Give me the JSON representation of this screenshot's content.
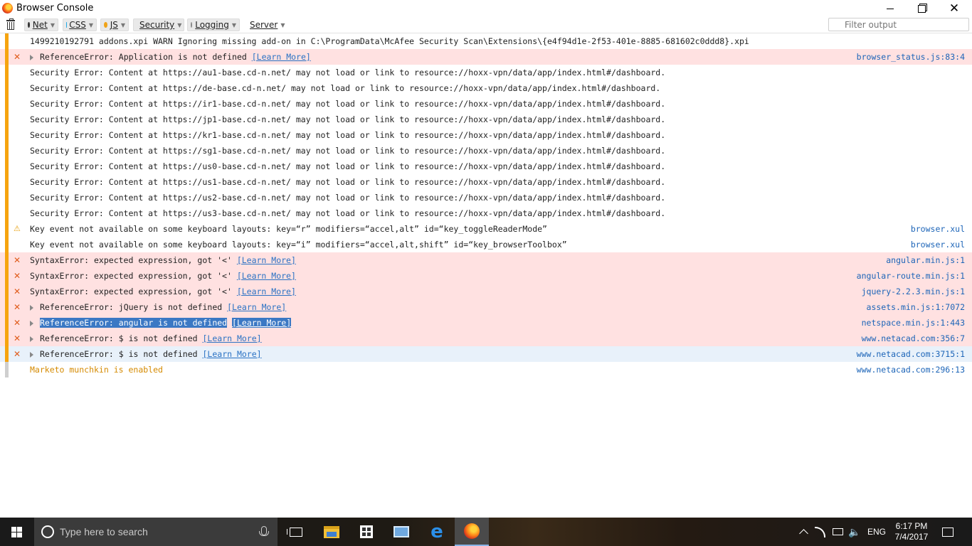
{
  "window": {
    "title": "Browser Console",
    "min_glyph": "",
    "close_glyph": "✕"
  },
  "toolbar": {
    "filters": [
      {
        "label": "Net",
        "color": "#333333"
      },
      {
        "label": "CSS",
        "color": "#1fa8e8"
      },
      {
        "label": "JS",
        "color": "#f0a318"
      },
      {
        "label": "Security",
        "color": "#e23b3b"
      },
      {
        "label": "Logging",
        "color": "#8a8a8a"
      },
      {
        "label": "Server",
        "color": "#3aa23a"
      }
    ],
    "filter_placeholder": "Filter output"
  },
  "console": {
    "rows": [
      {
        "type": "log",
        "sev": "",
        "twisty": false,
        "text": "1499210192791 addons.xpi WARN Ignoring missing add-on in C:\\ProgramData\\McAfee Security Scan\\Extensions\\{e4f94d1e-2f53-401e-8885-681602c0ddd8}.xpi",
        "link": "",
        "src": ""
      },
      {
        "type": "error",
        "sev": "✕",
        "twisty": true,
        "text": "ReferenceError: Application is not defined",
        "link": "[Learn More]",
        "src": "browser_status.js:83:4"
      },
      {
        "type": "log",
        "sev": "",
        "twisty": false,
        "text": "Security Error: Content at https://au1-base.cd-n.net/ may not load or link to resource://hoxx-vpn/data/app/index.html#/dashboard.",
        "link": "",
        "src": ""
      },
      {
        "type": "log",
        "sev": "",
        "twisty": false,
        "text": "Security Error: Content at https://de-base.cd-n.net/ may not load or link to resource://hoxx-vpn/data/app/index.html#/dashboard.",
        "link": "",
        "src": ""
      },
      {
        "type": "log",
        "sev": "",
        "twisty": false,
        "text": "Security Error: Content at https://ir1-base.cd-n.net/ may not load or link to resource://hoxx-vpn/data/app/index.html#/dashboard.",
        "link": "",
        "src": ""
      },
      {
        "type": "log",
        "sev": "",
        "twisty": false,
        "text": "Security Error: Content at https://jp1-base.cd-n.net/ may not load or link to resource://hoxx-vpn/data/app/index.html#/dashboard.",
        "link": "",
        "src": ""
      },
      {
        "type": "log",
        "sev": "",
        "twisty": false,
        "text": "Security Error: Content at https://kr1-base.cd-n.net/ may not load or link to resource://hoxx-vpn/data/app/index.html#/dashboard.",
        "link": "",
        "src": ""
      },
      {
        "type": "log",
        "sev": "",
        "twisty": false,
        "text": "Security Error: Content at https://sg1-base.cd-n.net/ may not load or link to resource://hoxx-vpn/data/app/index.html#/dashboard.",
        "link": "",
        "src": ""
      },
      {
        "type": "log",
        "sev": "",
        "twisty": false,
        "text": "Security Error: Content at https://us0-base.cd-n.net/ may not load or link to resource://hoxx-vpn/data/app/index.html#/dashboard.",
        "link": "",
        "src": ""
      },
      {
        "type": "log",
        "sev": "",
        "twisty": false,
        "text": "Security Error: Content at https://us1-base.cd-n.net/ may not load or link to resource://hoxx-vpn/data/app/index.html#/dashboard.",
        "link": "",
        "src": ""
      },
      {
        "type": "log",
        "sev": "",
        "twisty": false,
        "text": "Security Error: Content at https://us2-base.cd-n.net/ may not load or link to resource://hoxx-vpn/data/app/index.html#/dashboard.",
        "link": "",
        "src": ""
      },
      {
        "type": "log",
        "sev": "",
        "twisty": false,
        "text": "Security Error: Content at https://us3-base.cd-n.net/ may not load or link to resource://hoxx-vpn/data/app/index.html#/dashboard.",
        "link": "",
        "src": ""
      },
      {
        "type": "warn",
        "sev": "⚠",
        "twisty": false,
        "text": "Key event not available on some keyboard layouts: key=“r” modifiers=“accel,alt” id=“key_toggleReaderMode”",
        "link": "",
        "src": "browser.xul"
      },
      {
        "type": "warn",
        "sev": "",
        "twisty": false,
        "text": "Key event not available on some keyboard layouts: key=“i” modifiers=“accel,alt,shift” id=“key_browserToolbox”",
        "link": "",
        "src": "browser.xul"
      },
      {
        "type": "error",
        "sev": "✕",
        "twisty": false,
        "text": "SyntaxError: expected expression, got '<'",
        "link": "[Learn More]",
        "src": "angular.min.js:1"
      },
      {
        "type": "error",
        "sev": "✕",
        "twisty": false,
        "text": "SyntaxError: expected expression, got '<'",
        "link": "[Learn More]",
        "src": "angular-route.min.js:1"
      },
      {
        "type": "error",
        "sev": "✕",
        "twisty": false,
        "text": "SyntaxError: expected expression, got '<'",
        "link": "[Learn More]",
        "src": "jquery-2.2.3.min.js:1"
      },
      {
        "type": "error",
        "sev": "✕",
        "twisty": true,
        "text": "ReferenceError: jQuery is not defined",
        "link": "[Learn More]",
        "src": "assets.min.js:1:7072"
      },
      {
        "type": "error",
        "sev": "✕",
        "twisty": true,
        "text": "ReferenceError: angular is not defined",
        "link": "[Learn More]",
        "src": "netspace.min.js:1:443",
        "highlight": true
      },
      {
        "type": "error",
        "sev": "✕",
        "twisty": true,
        "text": "ReferenceError: $ is not defined",
        "link": "[Learn More]",
        "src": "www.netacad.com:356:7"
      },
      {
        "type": "selected",
        "sev": "✕",
        "twisty": true,
        "text": "ReferenceError: $ is not defined",
        "link": "[Learn More]",
        "src": "www.netacad.com:3715:1"
      },
      {
        "type": "info",
        "sev": "",
        "twisty": false,
        "text": "Marketo munchkin is enabled",
        "link": "",
        "src": "www.netacad.com:296:13",
        "orange": true
      }
    ]
  },
  "taskbar": {
    "search_placeholder": "Type here to search",
    "language": "ENG",
    "time": "6:17 PM",
    "date": "7/4/2017"
  },
  "icons": {
    "app": "firefox-icon",
    "trash": "trash-icon",
    "filter": "funnel-icon",
    "start": "windows-start-icon",
    "volume_glyph": "🔈"
  }
}
